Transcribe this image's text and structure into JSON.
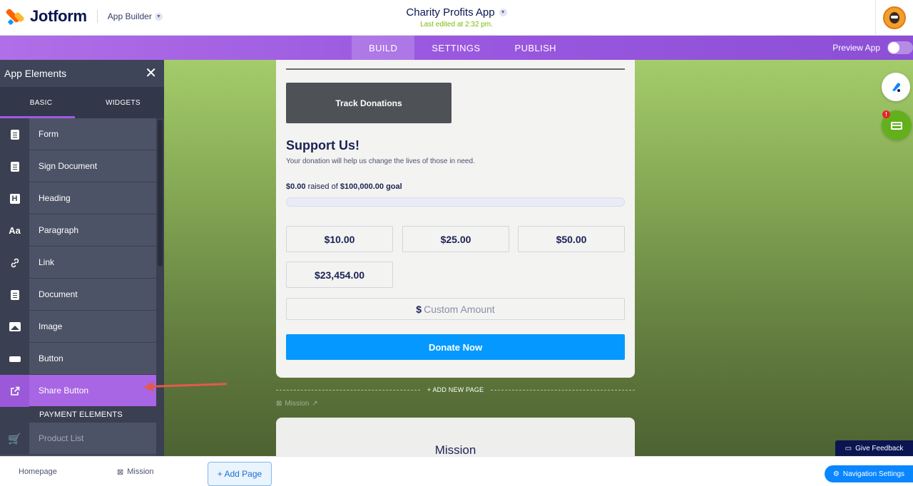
{
  "header": {
    "brand": "Jotform",
    "builder_label": "App Builder",
    "app_title": "Charity Profits App",
    "last_edited": "Last edited at 2:32 pm."
  },
  "nav": {
    "tabs": [
      {
        "label": "BUILD",
        "active": true
      },
      {
        "label": "SETTINGS",
        "active": false
      },
      {
        "label": "PUBLISH",
        "active": false
      }
    ],
    "preview_label": "Preview App"
  },
  "panel": {
    "title": "App Elements",
    "tabs": [
      "BASIC",
      "WIDGETS"
    ],
    "elements": [
      {
        "label": "Form",
        "icon": "form-icon"
      },
      {
        "label": "Sign Document",
        "icon": "sign-document-icon"
      },
      {
        "label": "Heading",
        "icon": "heading-icon"
      },
      {
        "label": "Paragraph",
        "icon": "paragraph-icon"
      },
      {
        "label": "Link",
        "icon": "link-icon"
      },
      {
        "label": "Document",
        "icon": "document-icon"
      },
      {
        "label": "Image",
        "icon": "image-icon"
      },
      {
        "label": "Button",
        "icon": "button-icon"
      },
      {
        "label": "Share Button",
        "icon": "share-icon"
      }
    ],
    "payment_header": "PAYMENT ELEMENTS",
    "payment_elements": [
      {
        "label": "Product List",
        "icon": "cart-icon"
      }
    ]
  },
  "page": {
    "track_button": "Track Donations",
    "support_title": "Support Us!",
    "support_subtitle": "Your donation will help us change the lives of those in need.",
    "raised_amount": "$0.00",
    "raised_mid": " raised of ",
    "goal_amount": "$100,000.00",
    "goal_suffix": " goal",
    "progress_fraction": 0,
    "amounts": [
      "$10.00",
      "$25.00",
      "$50.00",
      "$23,454.00"
    ],
    "custom_symbol": "$",
    "custom_placeholder": "Custom Amount",
    "donate_label": "Donate Now"
  },
  "add_new_page": "+ ADD NEW PAGE",
  "mission_tag": "Mission",
  "page2_title": "Mission",
  "give_feedback": "Give Feedback",
  "bottom": {
    "pages": [
      "Homepage",
      "Mission"
    ],
    "add_page": "+ Add Page",
    "navigation_settings": "Navigation Settings"
  },
  "colors": {
    "accent_purple": "#a865e4",
    "donate_blue": "#0599ff",
    "brand_navy": "#0a1551",
    "canvas_green": "#83a653"
  }
}
